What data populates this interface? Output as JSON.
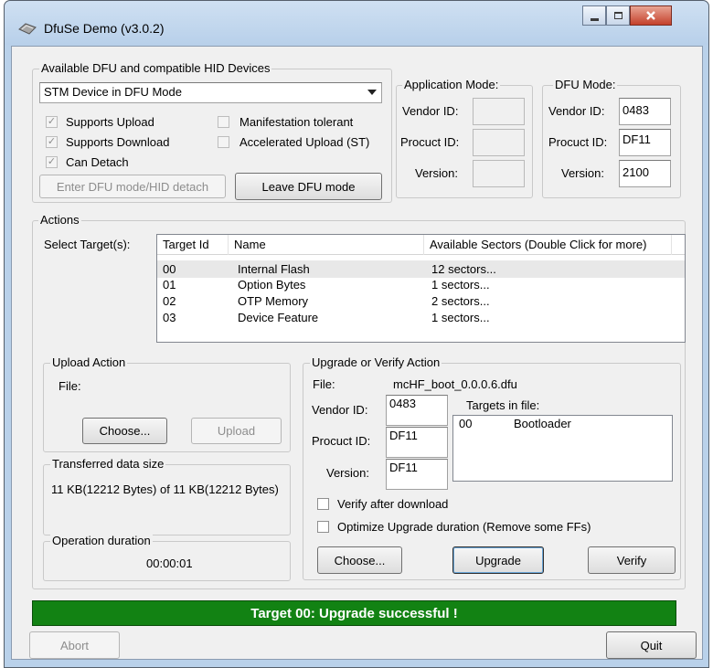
{
  "window": {
    "title": "DfuSe Demo (v3.0.2)"
  },
  "devices": {
    "group_label": "Available DFU and compatible HID Devices",
    "selected_device": "STM Device in DFU Mode",
    "checkboxes": [
      {
        "label": "Supports Upload",
        "checked": true
      },
      {
        "label": "Supports Download",
        "checked": true
      },
      {
        "label": "Can Detach",
        "checked": true
      },
      {
        "label": "Manifestation tolerant",
        "checked": false
      },
      {
        "label": "Accelerated Upload (ST)",
        "checked": false
      }
    ],
    "enter_dfu_label": "Enter DFU mode/HID detach",
    "leave_dfu_label": "Leave DFU mode"
  },
  "app_mode": {
    "label": "Application Mode:",
    "vendor_label": "Vendor ID:",
    "product_label": "Procuct ID:",
    "version_label": "Version:",
    "vendor": "",
    "product": "",
    "version": ""
  },
  "dfu_mode": {
    "label": "DFU Mode:",
    "vendor_label": "Vendor ID:",
    "product_label": "Procuct ID:",
    "version_label": "Version:",
    "vendor": "0483",
    "product": "DF11",
    "version": "2100"
  },
  "actions": {
    "group_label": "Actions",
    "select_target_label": "Select Target(s):",
    "columns": [
      "Target Id",
      "Name",
      "Available Sectors (Double Click for more)"
    ],
    "targets": [
      {
        "id": "00",
        "name": "Internal Flash",
        "sectors": "12 sectors..."
      },
      {
        "id": "01",
        "name": "Option Bytes",
        "sectors": "1 sectors..."
      },
      {
        "id": "02",
        "name": "OTP Memory",
        "sectors": "2 sectors..."
      },
      {
        "id": "03",
        "name": "Device Feature",
        "sectors": "1 sectors..."
      }
    ]
  },
  "upload": {
    "group_label": "Upload Action",
    "file_label": "File:",
    "choose_label": "Choose...",
    "upload_label": "Upload"
  },
  "transferred": {
    "group_label": "Transferred data size",
    "text": "11 KB(12212 Bytes) of 11 KB(12212 Bytes)"
  },
  "duration": {
    "group_label": "Operation duration",
    "value": "00:00:01"
  },
  "upgrade": {
    "group_label": "Upgrade or Verify Action",
    "file_label": "File:",
    "file_name": "mcHF_boot_0.0.0.6.dfu",
    "vendor_label": "Vendor ID:",
    "product_label": "Procuct ID:",
    "version_label": "Version:",
    "vendor": "0483",
    "product": "DF11",
    "version": "DF11",
    "targets_label": "Targets in file:",
    "targets_in_file": [
      {
        "id": "00",
        "name": "Bootloader"
      }
    ],
    "verify_label": "Verify after download",
    "optimize_label": "Optimize Upgrade duration (Remove some FFs)",
    "choose_label": "Choose...",
    "upgrade_label": "Upgrade",
    "verify_button_label": "Verify"
  },
  "status_text": "Target 00: Upgrade successful !",
  "abort_label": "Abort",
  "quit_label": "Quit",
  "colors": {
    "status_green": "#128213",
    "title_bar": "#b9d1ea"
  }
}
